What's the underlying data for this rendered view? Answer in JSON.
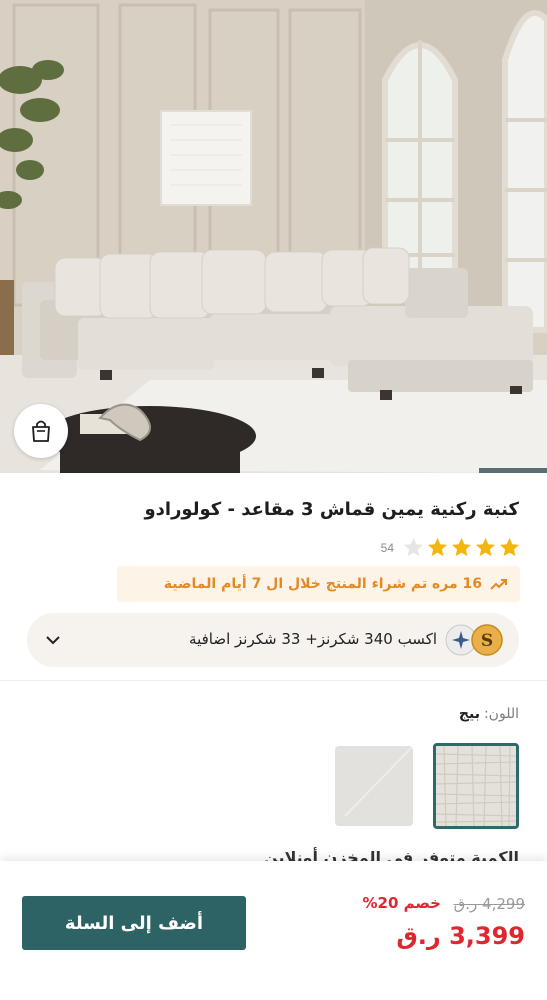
{
  "product": {
    "title": "كنبة ركنية يمين قماش 3 مقاعد - كولورادو",
    "rating_stars": 4,
    "rating_max": 5,
    "rating_count": "54"
  },
  "trend_banner": {
    "text": "16 مره تم شراء المنتج خلال ال 7 أيام الماضية",
    "icon": "trending-up-icon",
    "color": "#e48a24"
  },
  "rewards": {
    "text": "اكسب 340 شكرنز+  33 شكرنز اضافية",
    "coin_letter": "S"
  },
  "color_option": {
    "label": "اللون:",
    "value": "بيج"
  },
  "partial_section": {
    "text": "الكمية  متوفر في المخزن أونلاين"
  },
  "pricing": {
    "old_price": "4,299 ر.ق",
    "discount": "خصم 20%",
    "price": "3,399 ر.ق"
  },
  "actions": {
    "add_to_cart": "أضف إلى السلة"
  },
  "colors": {
    "accent": "#2d6364",
    "sale": "#e0262f",
    "star": "#f5b50c"
  }
}
